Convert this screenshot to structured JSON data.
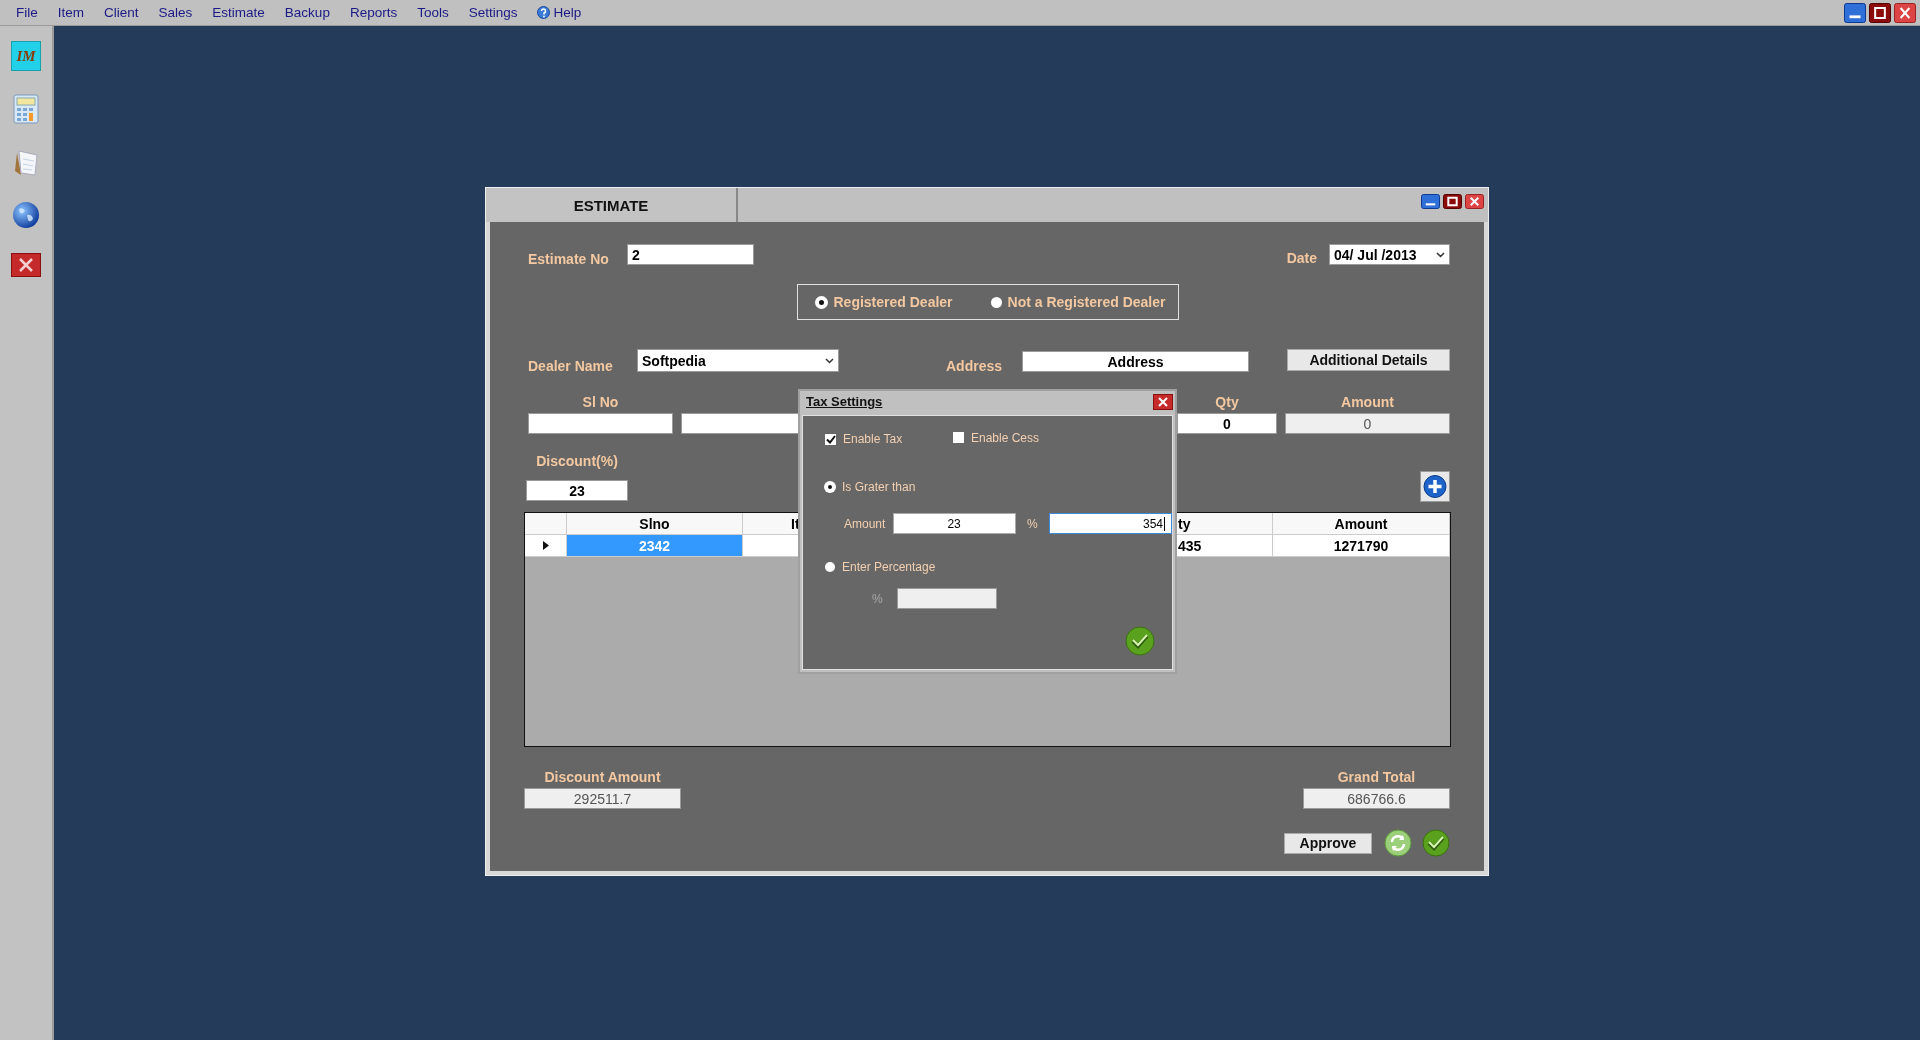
{
  "menu": [
    {
      "label": "File",
      "kind": "plain"
    },
    {
      "label": "Item",
      "kind": "plain"
    },
    {
      "label": "Client",
      "kind": "plain"
    },
    {
      "label": "Sales",
      "kind": "plain"
    },
    {
      "label": "Estimate",
      "kind": "plain"
    },
    {
      "label": "Backup",
      "kind": "plain"
    },
    {
      "label": "Reports",
      "kind": "plain"
    },
    {
      "label": "Tools",
      "kind": "plain"
    },
    {
      "label": "Settings",
      "kind": "plain"
    },
    {
      "label": "Help",
      "kind": "help"
    }
  ],
  "sidebar": {
    "items": [
      {
        "kind": "logo",
        "label": "IM"
      },
      {
        "kind": "calculator"
      },
      {
        "kind": "notepad"
      },
      {
        "kind": "globe"
      },
      {
        "kind": "exit"
      }
    ]
  },
  "estimate_window": {
    "title": "ESTIMATE",
    "estimate_no": {
      "label": "Estimate No",
      "value": "2"
    },
    "date": {
      "label": "Date",
      "value": "04/ Jul /2013"
    },
    "dealer_type": [
      {
        "label": "Registered Dealer",
        "selected": true
      },
      {
        "label": "Not a Registered Dealer",
        "selected": false
      }
    ],
    "dealer_name": {
      "label": "Dealer Name",
      "value": "Softpedia"
    },
    "address": {
      "label": "Address",
      "value": "Address"
    },
    "additional_details_button": "Additional Details",
    "entry_fields": [
      {
        "label": "Sl No",
        "disabled": false
      },
      {
        "disabled": false
      },
      {
        "label": "Qty",
        "value": "0",
        "disabled": false
      },
      {
        "label": "Amount",
        "value": "0",
        "disabled": true
      }
    ],
    "discount": {
      "label": "Discount(%)",
      "value": "23"
    },
    "grid": {
      "columns": [
        {
          "label": "Slno"
        },
        {
          "label": "It"
        },
        {
          "label": "ty"
        },
        {
          "label": "Amount"
        }
      ],
      "rows": [
        {
          "current": true,
          "cells": [
            {
              "value": "2342",
              "selected": true
            },
            {
              "selected": false
            },
            {
              "value": "435",
              "selected": false
            },
            {
              "value": "1271790",
              "selected": false
            }
          ]
        }
      ]
    },
    "discount_amount": {
      "label": "Discount Amount",
      "value": "292511.7"
    },
    "grand_total": {
      "label": "Grand Total",
      "value": "686766.6"
    },
    "approve_button": "Approve"
  },
  "tax_dialog": {
    "title": "Tax Settings",
    "checks": [
      {
        "label": "Enable Tax",
        "checked": true
      },
      {
        "label": "Enable Cess",
        "checked": false
      }
    ],
    "options": [
      {
        "label": "Is Grater than",
        "selected": true
      },
      {
        "label": "Enter Percentage",
        "selected": false
      }
    ],
    "amount": {
      "label": "Amount",
      "value": "23"
    },
    "percent_sign": "%",
    "percent_value": {
      "value": "354",
      "focused": true
    },
    "percentage_field": {
      "label": "%",
      "disabled": true
    }
  }
}
